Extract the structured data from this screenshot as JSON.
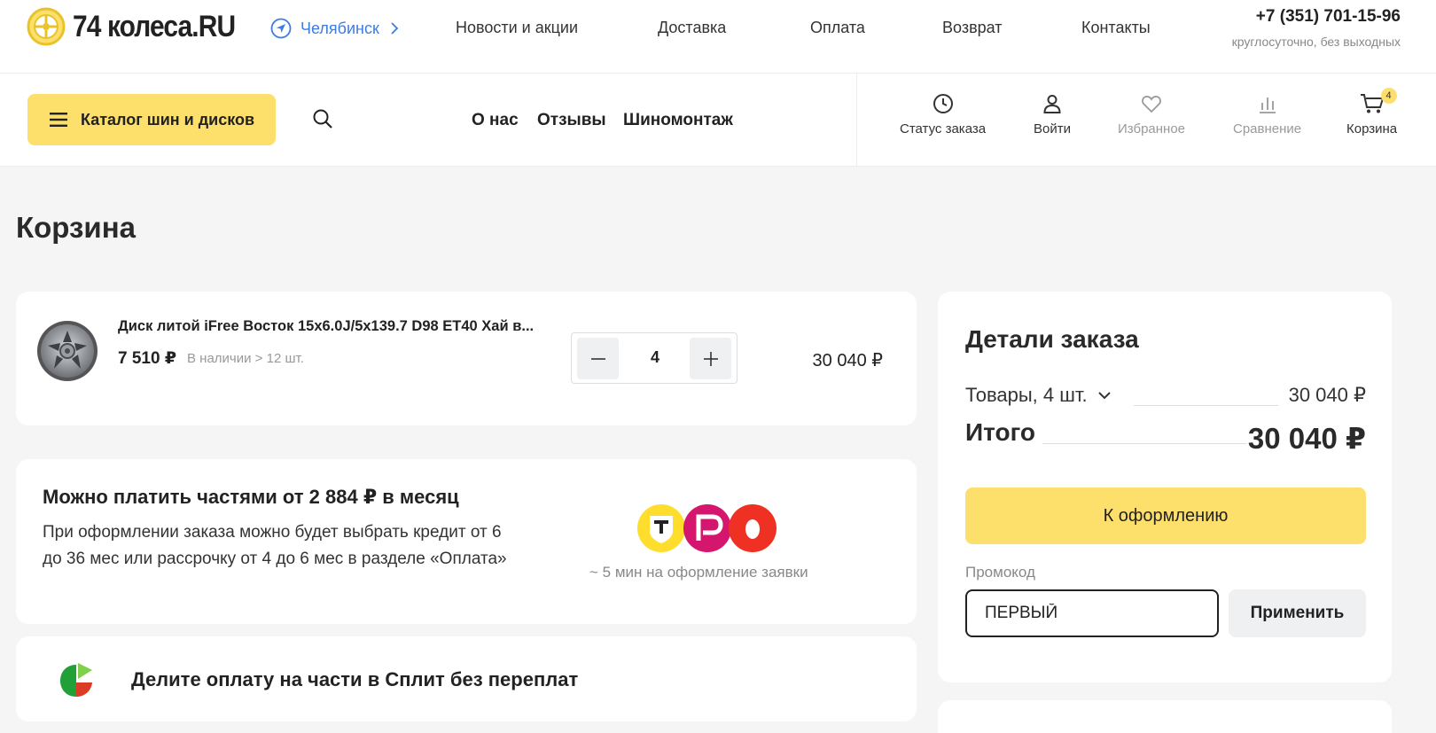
{
  "header": {
    "logo_text": "74 колеса.RU",
    "city": "Челябинск",
    "nav": [
      "Новости и акции",
      "Доставка",
      "Оплата",
      "Возврат",
      "Контакты"
    ],
    "phone": "+7 (351) 701-15-96",
    "phone_note": "круглосуточно, без выходных"
  },
  "navbar": {
    "catalog_label": "Каталог шин и дисков",
    "links": [
      "О нас",
      "Отзывы",
      "Шиномонтаж"
    ],
    "actions": {
      "order_status": "Статус заказа",
      "login": "Войти",
      "favorites": "Избранное",
      "compare": "Сравнение",
      "cart": "Корзина",
      "cart_count": "4"
    }
  },
  "page_title": "Корзина",
  "cart_item": {
    "title": "Диск литой iFree Восток 15x6.0J/5x139.7 D98 ET40 Хай в...",
    "price": "7 510 ₽",
    "stock": "В наличии > 12 шт.",
    "quantity": "4",
    "total": "30 040 ₽"
  },
  "credit": {
    "title": "Можно платить частями от 2 884 ₽ в месяц",
    "text": "При оформлении заказа можно будет выбрать кредит от 6 до 36 мес или рассрочку от 4 до 6 мес в разделе «Оплата»",
    "note": "~ 5 мин на оформление заявки"
  },
  "split": {
    "text": "Делите оплату на части в Сплит без переплат"
  },
  "order": {
    "title": "Детали заказа",
    "goods_label": "Товары, 4 шт.",
    "goods_value": "30 040 ₽",
    "total_label": "Итого",
    "total_value": "30 040 ₽",
    "checkout_label": "К оформлению",
    "promo_label": "Промокод",
    "promo_value": "ПЕРВЫЙ",
    "apply_label": "Применить"
  },
  "colors": {
    "accent_yellow": "#fde06c",
    "link_blue": "#3b7de0",
    "bank_yellow": "#ffdd2d",
    "bank_pink": "#d4166e",
    "bank_red": "#ef3124",
    "split_green": "#21a038"
  }
}
